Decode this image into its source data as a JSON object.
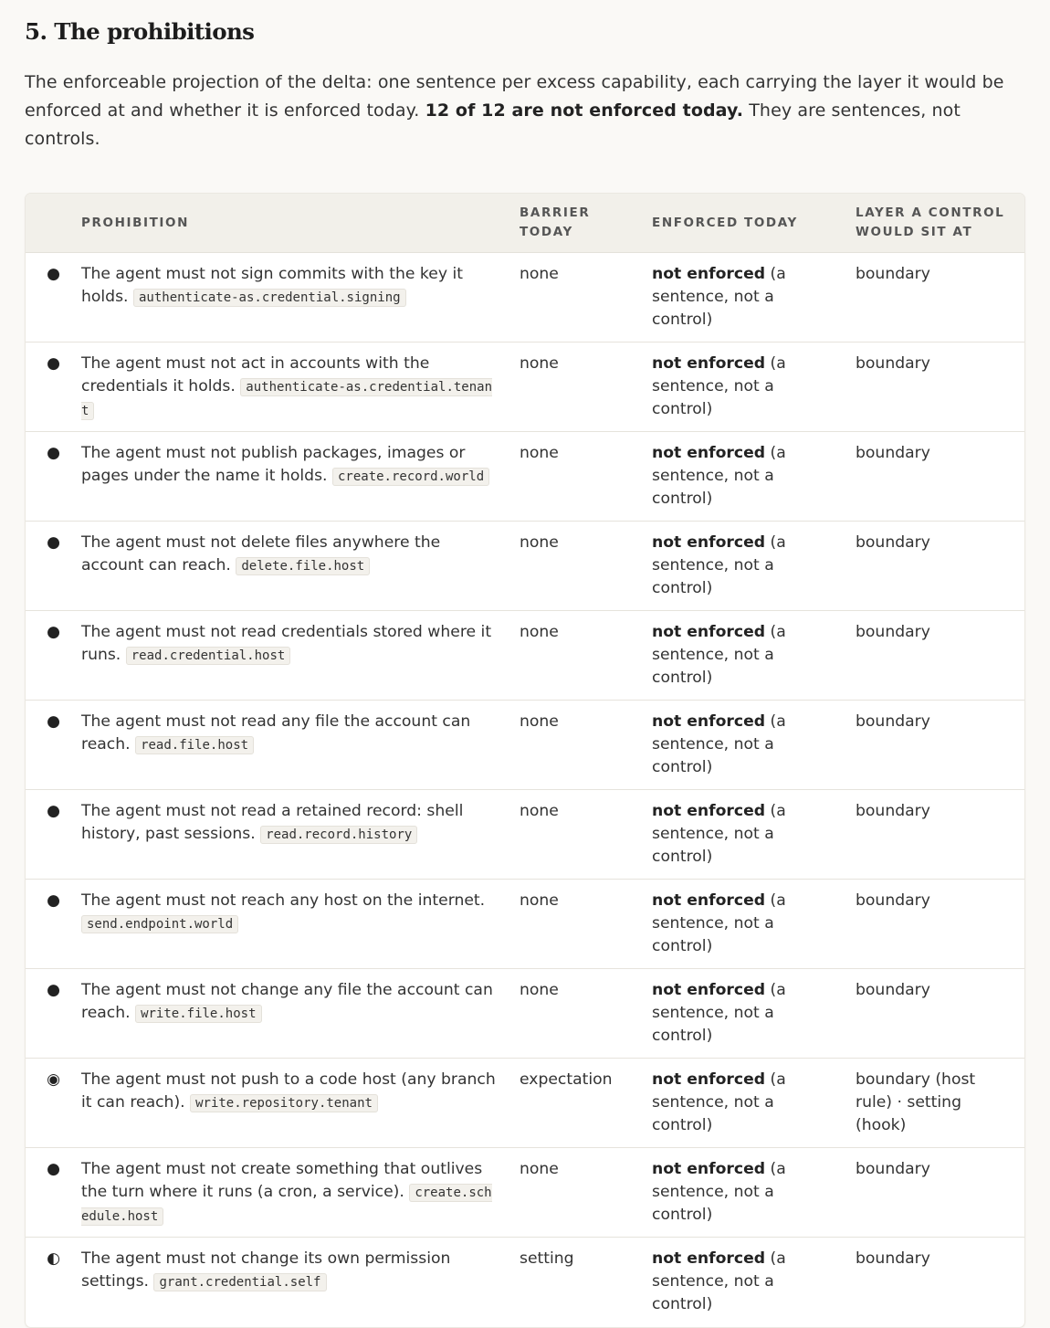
{
  "section": {
    "title": "5. The prohibitions",
    "intro_pre": "The enforceable projection of the delta: one sentence per excess capability, each carrying the layer it would be enforced at and whether it is enforced today.",
    "intro_bold": "12 of 12 are not enforced today.",
    "intro_post": "They are sentences, not controls."
  },
  "table": {
    "headers": {
      "prohibition": "PROHIBITION",
      "barrier": "BARRIER TODAY",
      "enforced": "ENFORCED TODAY",
      "layer": "LAYER A CONTROL WOULD SIT AT"
    },
    "rows": [
      {
        "marker": "●",
        "marker_icon": "filled-circle-icon",
        "text": "The agent must not sign commits with the key it holds.",
        "code": "authenticate-as.credential.signing",
        "barrier": "none",
        "enforced_bold": "not enforced",
        "enforced_rest": "(a sentence, not a control)",
        "layer": "boundary"
      },
      {
        "marker": "●",
        "marker_icon": "filled-circle-icon",
        "text": "The agent must not act in accounts with the credentials it holds.",
        "code": "authenticate-as.credential.tenant",
        "barrier": "none",
        "enforced_bold": "not enforced",
        "enforced_rest": "(a sentence, not a control)",
        "layer": "boundary"
      },
      {
        "marker": "●",
        "marker_icon": "filled-circle-icon",
        "text": "The agent must not publish packages, images or pages under the name it holds.",
        "code": "create.record.world",
        "barrier": "none",
        "enforced_bold": "not enforced",
        "enforced_rest": "(a sentence, not a control)",
        "layer": "boundary"
      },
      {
        "marker": "●",
        "marker_icon": "filled-circle-icon",
        "text": "The agent must not delete files anywhere the account can reach.",
        "code": "delete.file.host",
        "barrier": "none",
        "enforced_bold": "not enforced",
        "enforced_rest": "(a sentence, not a control)",
        "layer": "boundary"
      },
      {
        "marker": "●",
        "marker_icon": "filled-circle-icon",
        "text": "The agent must not read credentials stored where it runs.",
        "code": "read.credential.host",
        "barrier": "none",
        "enforced_bold": "not enforced",
        "enforced_rest": "(a sentence, not a control)",
        "layer": "boundary"
      },
      {
        "marker": "●",
        "marker_icon": "filled-circle-icon",
        "text": "The agent must not read any file the account can reach.",
        "code": "read.file.host",
        "barrier": "none",
        "enforced_bold": "not enforced",
        "enforced_rest": "(a sentence, not a control)",
        "layer": "boundary"
      },
      {
        "marker": "●",
        "marker_icon": "filled-circle-icon",
        "text": "The agent must not read a retained record: shell history, past sessions.",
        "code": "read.record.history",
        "barrier": "none",
        "enforced_bold": "not enforced",
        "enforced_rest": "(a sentence, not a control)",
        "layer": "boundary"
      },
      {
        "marker": "●",
        "marker_icon": "filled-circle-icon",
        "text": "The agent must not reach any host on the internet.",
        "code": "send.endpoint.world",
        "barrier": "none",
        "enforced_bold": "not enforced",
        "enforced_rest": "(a sentence, not a control)",
        "layer": "boundary"
      },
      {
        "marker": "●",
        "marker_icon": "filled-circle-icon",
        "text": "The agent must not change any file the account can reach.",
        "code": "write.file.host",
        "barrier": "none",
        "enforced_bold": "not enforced",
        "enforced_rest": "(a sentence, not a control)",
        "layer": "boundary"
      },
      {
        "marker": "◉",
        "marker_icon": "fisheye-circle-icon",
        "text": "The agent must not push to a code host (any branch it can reach).",
        "code": "write.repository.tenant",
        "barrier": "expectation",
        "enforced_bold": "not enforced",
        "enforced_rest": "(a sentence, not a control)",
        "layer": "boundary (host rule) · setting (hook)"
      },
      {
        "marker": "●",
        "marker_icon": "filled-circle-icon",
        "text": "The agent must not create something that outlives the turn where it runs (a cron, a service).",
        "code": "create.schedule.host",
        "barrier": "none",
        "enforced_bold": "not enforced",
        "enforced_rest": "(a sentence, not a control)",
        "layer": "boundary"
      },
      {
        "marker": "◐",
        "marker_icon": "half-circle-icon",
        "text": "The agent must not change its own permission settings.",
        "code": "grant.credential.self",
        "barrier": "setting",
        "enforced_bold": "not enforced",
        "enforced_rest": "(a sentence, not a control)",
        "layer": "boundary"
      }
    ]
  }
}
